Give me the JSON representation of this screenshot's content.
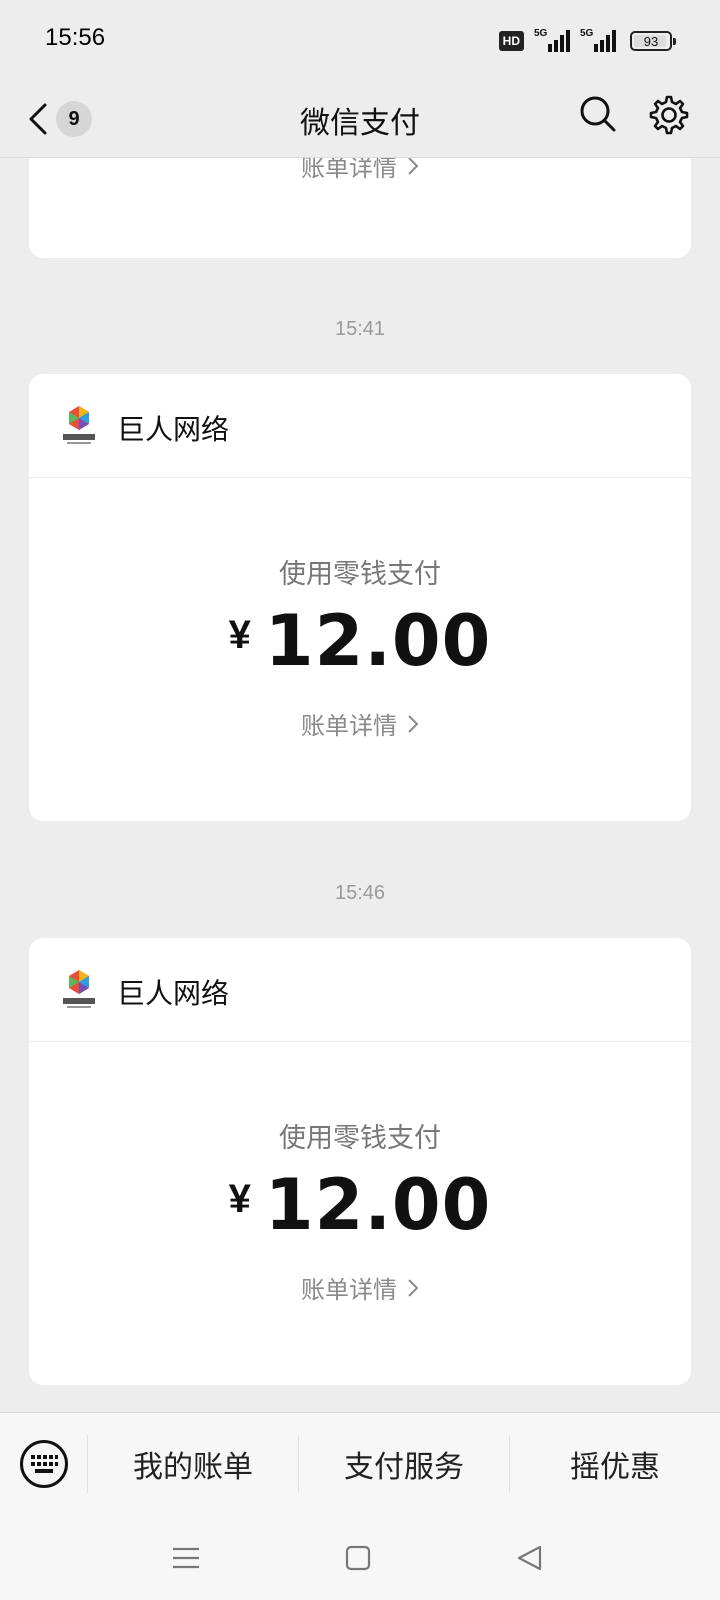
{
  "status_bar": {
    "time": "15:56",
    "hd_label": "HD",
    "sim1_label": "5G",
    "sim2_label": "5G",
    "battery": "93",
    "battery_level": 0.93
  },
  "nav": {
    "title": "微信支付",
    "unread_count": "9",
    "back_icon": "chevron-left-icon",
    "search_icon": "search-icon",
    "settings_icon": "gear-icon"
  },
  "feed": {
    "partial_card": {
      "detail_label": "账单详情"
    },
    "messages": [
      {
        "time": "15:41",
        "merchant": "巨人网络",
        "method": "使用零钱支付",
        "currency": "¥",
        "amount": "12.00",
        "detail_label": "账单详情"
      },
      {
        "time": "15:46",
        "merchant": "巨人网络",
        "method": "使用零钱支付",
        "currency": "¥",
        "amount": "12.00",
        "detail_label": "账单详情"
      }
    ]
  },
  "bottom_menu": {
    "keyboard_icon": "keyboard-icon",
    "items": [
      "我的账单",
      "支付服务",
      "摇优惠"
    ]
  },
  "system_nav": {
    "menu_icon": "menu-icon",
    "home_icon": "home-square-icon",
    "back_icon": "back-triangle-icon"
  }
}
